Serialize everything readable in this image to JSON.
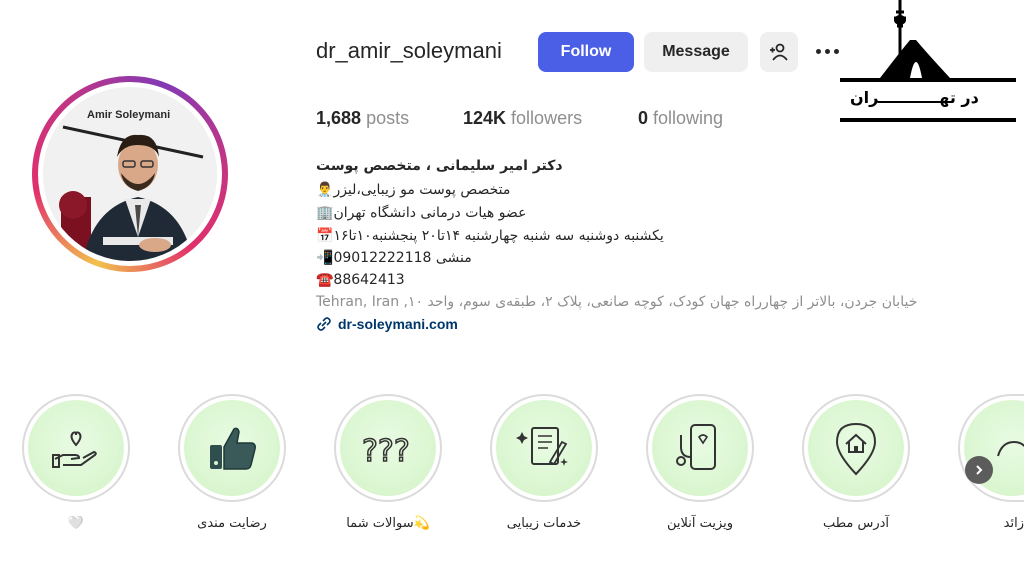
{
  "profile": {
    "username": "dr_amir_soleymani",
    "avatar_caption": "Amir Soleymani",
    "avatar_ring_colors": [
      "#f2c14e",
      "#e1306c",
      "#833ab4"
    ]
  },
  "actions": {
    "follow_label": "Follow",
    "message_label": "Message",
    "follow_color": "#4a5fe6"
  },
  "stats": {
    "posts_count": "1,688",
    "posts_label": "posts",
    "followers_count": "124K",
    "followers_label": "followers",
    "following_count": "0",
    "following_label": "following"
  },
  "bio": {
    "name": "دکتر امیر سلیمانی ، متخصص پوست",
    "line1": "👨‍⚕️متخصص پوست مو زیبایی،لیزر",
    "line2": "🏢عضو هیات درمانی دانشگاه تهران",
    "line3": "📅یکشنبه دوشنبه سه شنبه چهارشنبه ۱۴تا۲۰ پنجشنبه۱۰تا۱۶",
    "line4": "📲منشی 09012222118",
    "line5": "☎️88642413",
    "address": "Tehran, Iran ,خیابان جردن، بالاتر از چهارراه جهان کودک، کوچه صانعی، پلاک ۲، طبقه‌ی سوم، واحد ۱۰",
    "website": "dr-soleymani.com"
  },
  "highlights": [
    {
      "label": "🤍",
      "icon": "heart-hand-icon"
    },
    {
      "label": "رضایت مندی",
      "icon": "thumbs-up-icon"
    },
    {
      "label": "سوالات شما💫",
      "icon": "question-marks-icon"
    },
    {
      "label": "خدمات زیبایی",
      "icon": "clipboard-sparkle-icon"
    },
    {
      "label": "ویزیت آنلاین",
      "icon": "phone-stethoscope-icon"
    },
    {
      "label": "آدرس مطب",
      "icon": "location-home-icon"
    },
    {
      "label": "زائد",
      "icon": "hand-icon"
    }
  ],
  "watermark": {
    "text": "در تهـــــــــــران"
  }
}
